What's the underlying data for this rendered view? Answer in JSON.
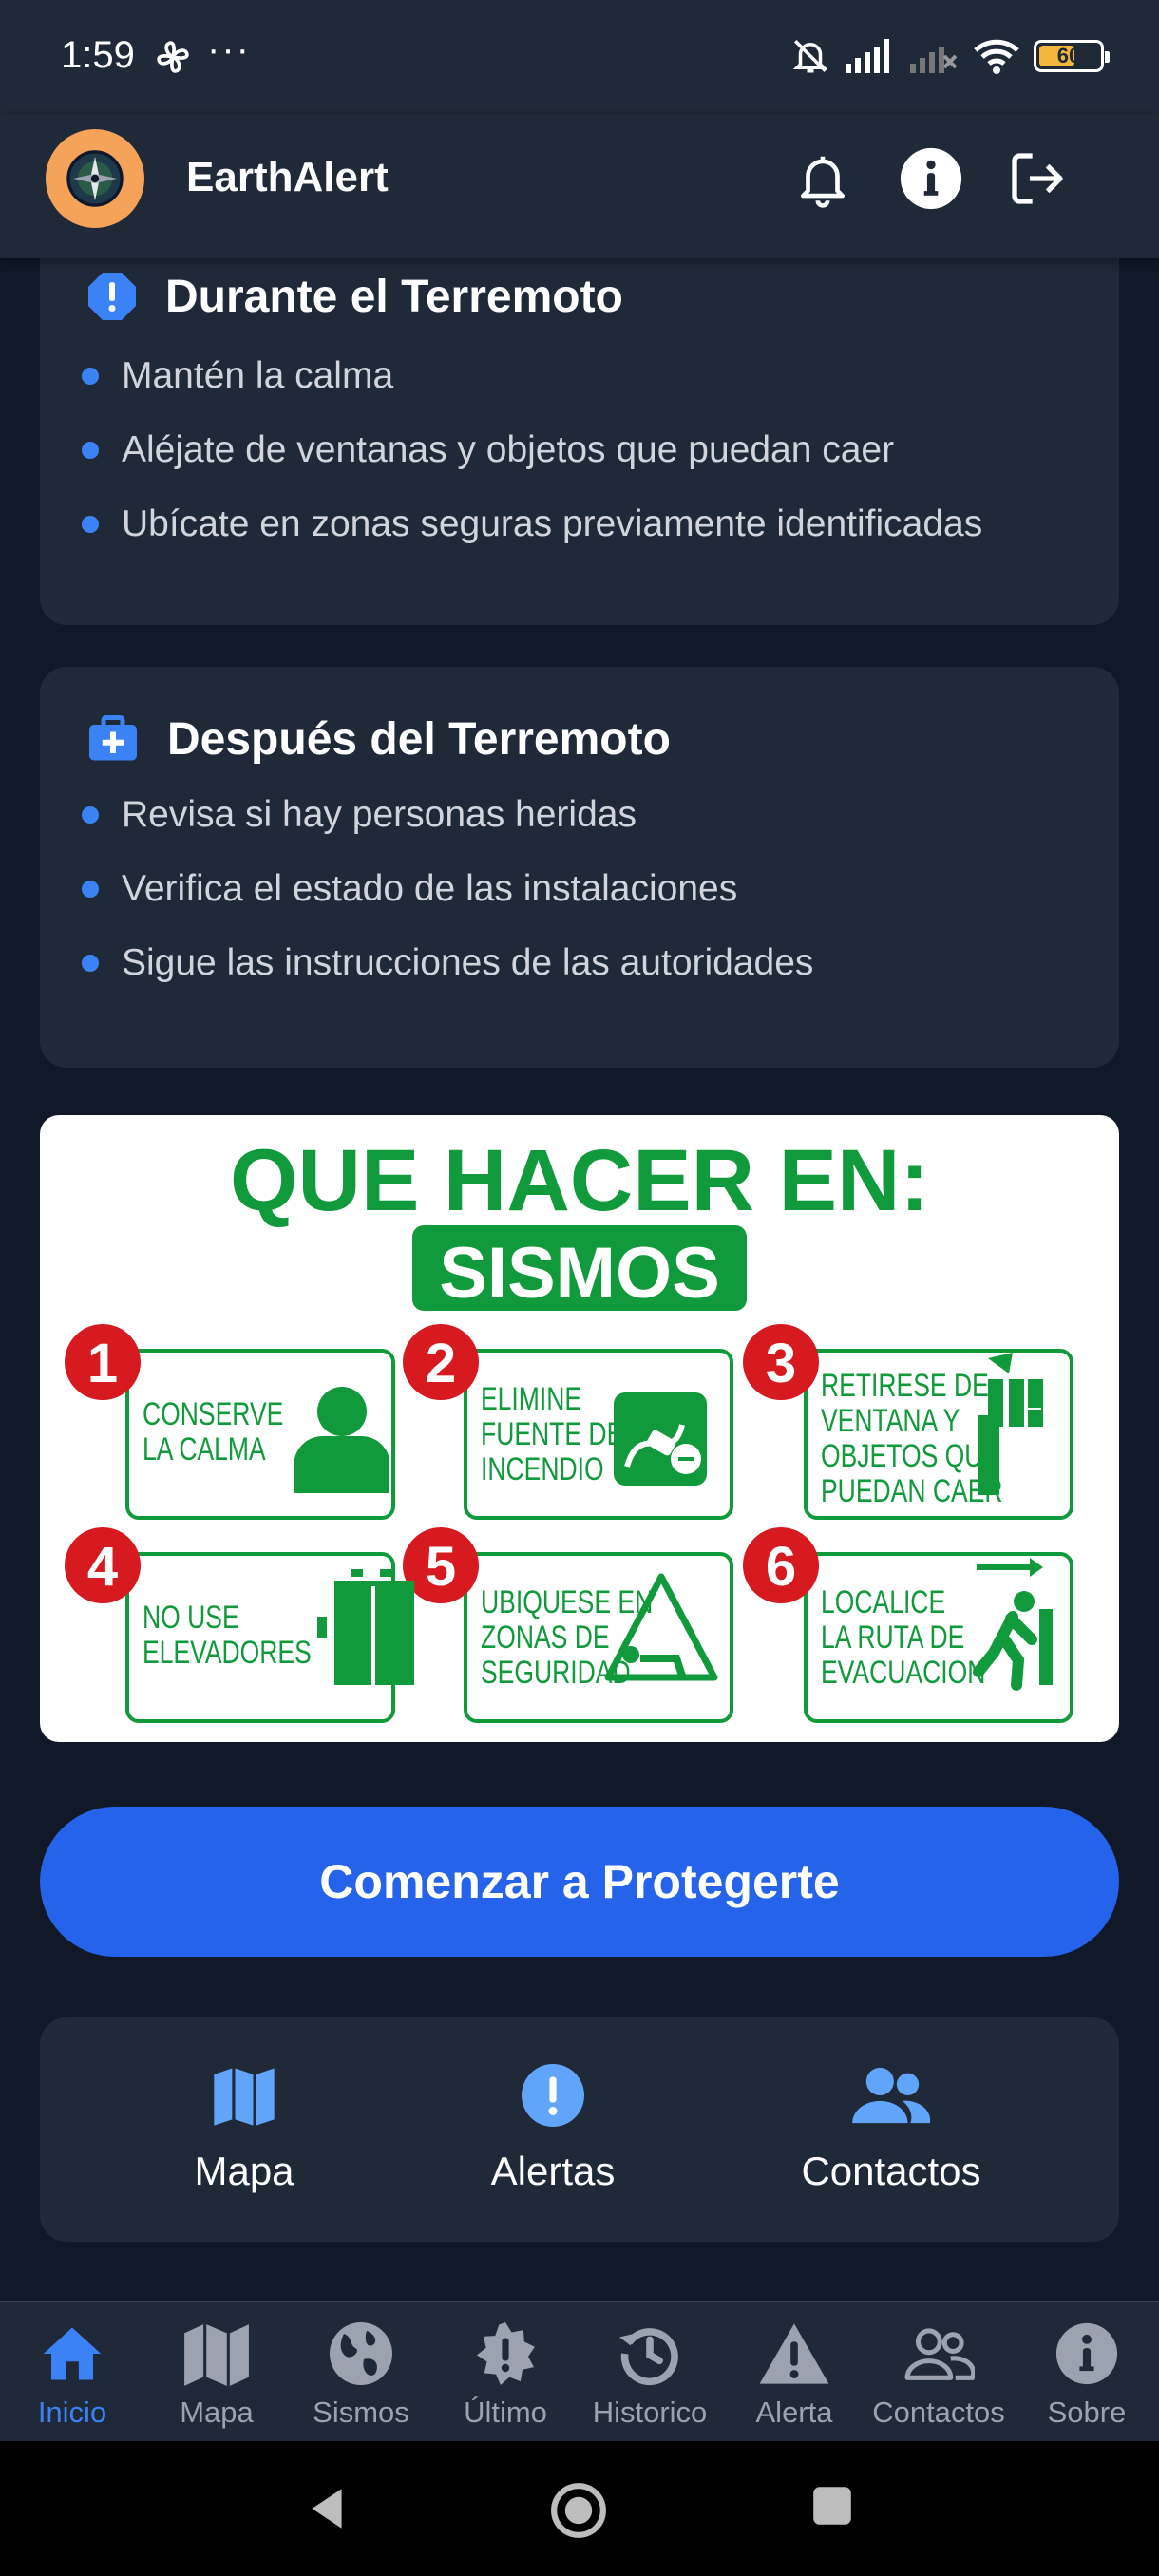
{
  "status_bar": {
    "time": "1:59",
    "dots": "···",
    "battery": "60",
    "battery_level": 0.6
  },
  "app": {
    "title": "EarthAlert"
  },
  "cards": {
    "during": {
      "title": "Durante el Terremoto",
      "items": [
        "Mantén la calma",
        "Aléjate de ventanas y objetos que puedan caer",
        "Ubícate en zonas seguras previamente identificadas"
      ]
    },
    "after": {
      "title": "Después del Terremoto",
      "items": [
        "Revisa si hay personas heridas",
        "Verifica el estado de las instalaciones",
        "Sigue las instrucciones de las autoridades"
      ]
    }
  },
  "poster": {
    "heading": "QUE HACER EN:",
    "badge": "SISMOS",
    "steps": [
      {
        "number": "1",
        "line1": "CONSERVE",
        "line2": "LA CALMA",
        "line3": ""
      },
      {
        "number": "2",
        "line1": "ELIMINE",
        "line2": "FUENTE DE",
        "line3": "INCENDIO"
      },
      {
        "number": "3",
        "line1": "RETIRESE DE",
        "line2": "VENTANA Y",
        "line3": "OBJETOS QUE",
        "line4": "PUEDAN CAER"
      },
      {
        "number": "4",
        "line1": "NO USE",
        "line2": "ELEVADORES",
        "line3": ""
      },
      {
        "number": "5",
        "line1": "UBIQUESE EN",
        "line2": "ZONAS DE",
        "line3": "SEGURIDAD"
      },
      {
        "number": "6",
        "line1": "LOCALICE",
        "line2": "LA RUTA DE",
        "line3": "EVACUACION"
      }
    ],
    "colors": {
      "green": "#119a3c",
      "red": "#d71920"
    }
  },
  "cta": {
    "label": "Comenzar a Protegerte"
  },
  "quick_actions": [
    {
      "label": "Mapa",
      "icon": "map-icon"
    },
    {
      "label": "Alertas",
      "icon": "alert-circle-icon"
    },
    {
      "label": "Contactos",
      "icon": "users-icon"
    }
  ],
  "bottom_nav": [
    {
      "label": "Inicio",
      "icon": "home-icon",
      "active": true
    },
    {
      "label": "Mapa",
      "icon": "map-icon"
    },
    {
      "label": "Sismos",
      "icon": "globe-icon"
    },
    {
      "label": "Último",
      "icon": "burst-alert-icon"
    },
    {
      "label": "Historico",
      "icon": "history-icon"
    },
    {
      "label": "Alerta",
      "icon": "warning-triangle-icon"
    },
    {
      "label": "Contactos",
      "icon": "users-outline-icon"
    },
    {
      "label": "Sobre",
      "icon": "info-circle-icon"
    }
  ],
  "theme": {
    "background": "#111827",
    "card": "#1f2937",
    "accent": "#2563eb",
    "bullet": "#3b82f6",
    "logo_bg": "#f6a35a"
  }
}
